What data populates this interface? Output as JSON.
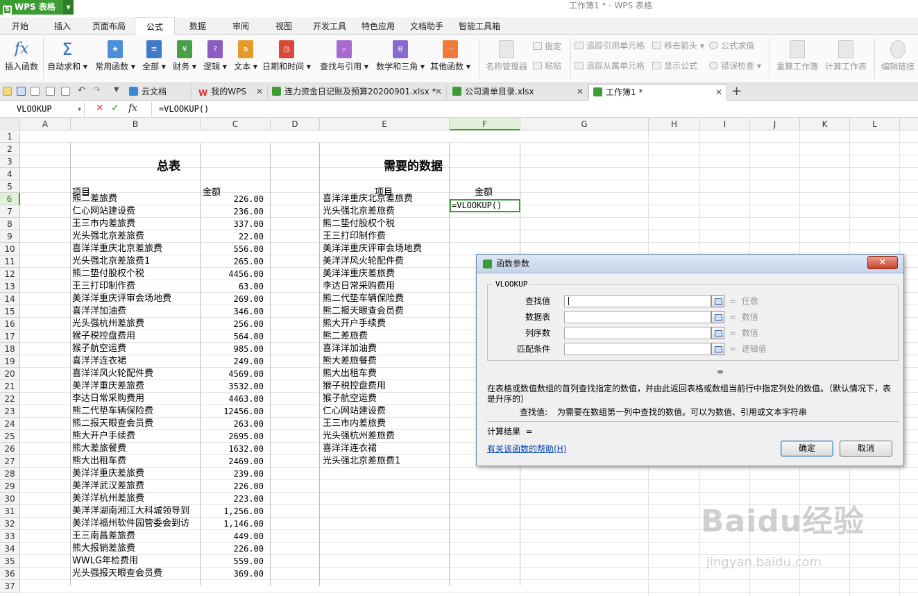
{
  "app": {
    "logo": "WPS 表格",
    "window_title": "工作簿1 * - WPS 表格"
  },
  "menus": [
    "开始",
    "插入",
    "页面布局",
    "公式",
    "数据",
    "审阅",
    "视图",
    "开发工具",
    "特色应用",
    "文档助手",
    "智能工具箱"
  ],
  "active_menu": "公式",
  "ribbon": {
    "insert_function": "插入函数",
    "autosum": "自动求和",
    "common": "常用函数",
    "all": "全部",
    "finance": "财务",
    "logic": "逻辑",
    "text": "文本",
    "datetime": "日期和时间",
    "lookup": "查找与引用",
    "math": "数学和三角",
    "other": "其他函数",
    "name_manager": "名称管理器",
    "specify": "指定",
    "paste": "粘贴",
    "trace_precedents": "追踪引用单元格",
    "remove_arrows": "移去箭头",
    "evaluate": "公式求值",
    "trace_dependents": "追踪从属单元格",
    "show_formula": "显示公式",
    "error_check": "错误检查",
    "recalc_book": "重算工作簿",
    "calc_sheet": "计算工作表",
    "edit_links": "编辑链接"
  },
  "doc_tabs": [
    "云文档",
    "我的WPS",
    "连力资金日记账及预算20200901.xlsx *",
    "公司清单目录.xlsx",
    "工作簿1 *"
  ],
  "formula_bar": {
    "name_box": "VLOOKUP",
    "formula": "=VLOOKUP()"
  },
  "columns": [
    "A",
    "B",
    "C",
    "D",
    "E",
    "F",
    "G",
    "H",
    "I",
    "J",
    "K",
    "L"
  ],
  "selected_column": "F",
  "selected_row": "6",
  "rows": [
    "1",
    "2",
    "3",
    "4",
    "5",
    "6",
    "7",
    "8",
    "9",
    "10",
    "11",
    "12",
    "13",
    "14",
    "15",
    "16",
    "17",
    "18",
    "19",
    "20",
    "21",
    "22",
    "23",
    "24",
    "25",
    "26",
    "27",
    "28",
    "29",
    "30",
    "31",
    "32",
    "33",
    "34",
    "35",
    "36",
    "37"
  ],
  "sheet": {
    "title_left": "总表",
    "title_right": "需要的数据",
    "header_item": "项目",
    "header_amount": "金额",
    "header_item2": "项目",
    "header_amount2": "金额",
    "active_cell_formula": "=VLOOKUP()",
    "left_items": [
      "熊二差旅费",
      "仁心网站建设费",
      "王三市内差旅费",
      "光头强北京差旅费",
      "喜洋洋重庆北京差旅费",
      "光头强北京差旅费1",
      "熊二垫付股权个税",
      "王三打印制作费",
      "美洋洋重庆评审会场地费",
      "喜洋洋加油费",
      "光头强杭州差旅费",
      "猴子税控盘费用",
      "猴子航空运费",
      "喜洋洋连衣裙",
      "喜洋洋风火轮配件费",
      "美洋洋重庆差旅费",
      "李达日常采购费用",
      "熊二代垫车辆保险费",
      "熊二报天眼查会员费",
      "熊大开户手续费",
      "熊大差旅餐费",
      "熊大出租车费",
      "美洋洋重庆差旅费",
      "美洋洋武汉差旅费",
      "美洋洋杭州差旅费",
      "美洋洋湖南湘江大科城领导到",
      "美洋洋福州软件园管委会到访",
      "王三南昌差旅费",
      "熊大报销差旅费",
      "WWLG年检费用",
      "光头强报天眼查会员费"
    ],
    "left_amounts": [
      "226.00",
      "236.00",
      "337.00",
      "22.00",
      "556.00",
      "265.00",
      "4456.00",
      "63.00",
      "269.00",
      "346.00",
      "256.00",
      "564.00",
      "985.00",
      "249.00",
      "4569.00",
      "3532.00",
      "4463.00",
      "12456.00",
      "263.00",
      "2695.00",
      "1632.00",
      "2469.00",
      "239.00",
      "226.00",
      "223.00",
      "1,256.00",
      "1,146.00",
      "449.00",
      "226.00",
      "559.00",
      "369.00"
    ],
    "right_items": [
      "喜洋洋重庆北京差旅费",
      "光头强北京差旅费",
      "熊二垫付股权个税",
      "王三打印制作费",
      "美洋洋重庆评审会场地费",
      "美洋洋风火轮配件费",
      "美洋洋重庆差旅费",
      "李达日常采购费用",
      "熊二代垫车辆保险费",
      "熊二报天眼查会员费",
      "熊大开户手续费",
      "熊二差旅费",
      "喜洋洋加油费",
      "熊大差旅餐费",
      "熊大出租车费",
      "猴子税控盘费用",
      "猴子航空运费",
      "仁心网站建设费",
      "王三市内差旅费",
      "光头强杭州差旅费",
      "喜洋洋连衣裙",
      "光头强北京差旅费1"
    ]
  },
  "dialog": {
    "title": "函数参数",
    "function_name": "VLOOKUP",
    "params": [
      {
        "label": "查找值",
        "hint": "任意"
      },
      {
        "label": "数据表",
        "hint": "数值"
      },
      {
        "label": "列序数",
        "hint": "数值"
      },
      {
        "label": "匹配条件",
        "hint": "逻辑值"
      }
    ],
    "eq": "=",
    "result_eq": "=",
    "description": "在表格或数值数组的首列查找指定的数值，并由此返回表格或数组当前行中指定列处的数值。（默认情况下，表是升序的）",
    "param_label": "查找值:",
    "param_description": "为需要在数组第一列中查找的数值。可以为数值、引用或文本字符串",
    "calc_result_label": "计算结果",
    "help_link": "有关该函数的帮助(H)",
    "ok": "确定",
    "cancel": "取消"
  },
  "watermark": {
    "brand": "Baidu经验",
    "url": "jingyan.baidu.com"
  }
}
